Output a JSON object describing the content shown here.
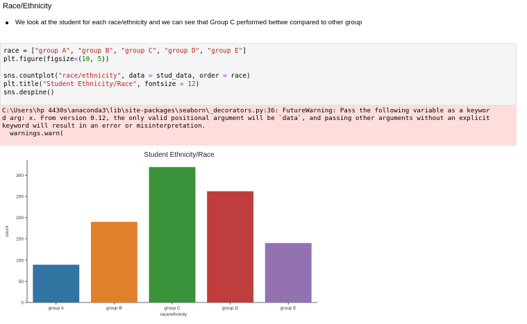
{
  "heading": "Race/Ethnicity",
  "bullet_text": "We look at the student for each race/ethnicity and we can see that Group C performed bettwe compared to other group",
  "code": {
    "line1": {
      "a": "race = [",
      "b": "\"group A\"",
      "c": ", ",
      "d": "\"group B\"",
      "e": ", ",
      "f": "\"group C\"",
      "g": ", ",
      "h": "\"group D\"",
      "i": ", ",
      "j": "\"group E\"",
      "k": "]"
    },
    "line2": {
      "a": "plt.figure(figsize",
      "b": "=",
      "c": "(",
      "d": "10",
      "e": ", ",
      "f": "5",
      "g": "))"
    },
    "line3": {
      "a": "sns.countplot(",
      "b": "\"race/ethnicity\"",
      "c": ", data ",
      "d": "=",
      "e": " stud_data, order ",
      "f": "=",
      "g": " race)"
    },
    "line4": {
      "a": "plt.title(",
      "b": "\"Student Ethnicity/Race\"",
      "c": ", fontsize ",
      "d": "=",
      "e": " ",
      "f": "12",
      "g": ")"
    },
    "line5": "sns.despine()"
  },
  "warning": {
    "line1": "C:\\Users\\hp 4430s\\anaconda3\\lib\\site-packages\\seaborn\\_decorators.py:36: FutureWarning: Pass the following variable as a keywor",
    "line2": "d arg: x. From version 0.12, the only valid positional argument will be `data`, and passing other arguments without an explicit",
    "line3": "keyword will result in an error or misinterpretation.",
    "line4": "  warnings.warn("
  },
  "chart_data": {
    "type": "bar",
    "title": "Student Ethnicity/Race",
    "xlabel": "race/ethnicity",
    "ylabel": "count",
    "categories": [
      "group A",
      "group B",
      "group C",
      "group D",
      "group E"
    ],
    "values": [
      89,
      190,
      319,
      262,
      140
    ],
    "colors": [
      "#3274a1",
      "#e1812c",
      "#3a923a",
      "#c03d3e",
      "#9372b2"
    ],
    "yticks": [
      0,
      50,
      100,
      150,
      200,
      250,
      300
    ],
    "ylim": [
      0,
      335
    ],
    "grid": false
  }
}
